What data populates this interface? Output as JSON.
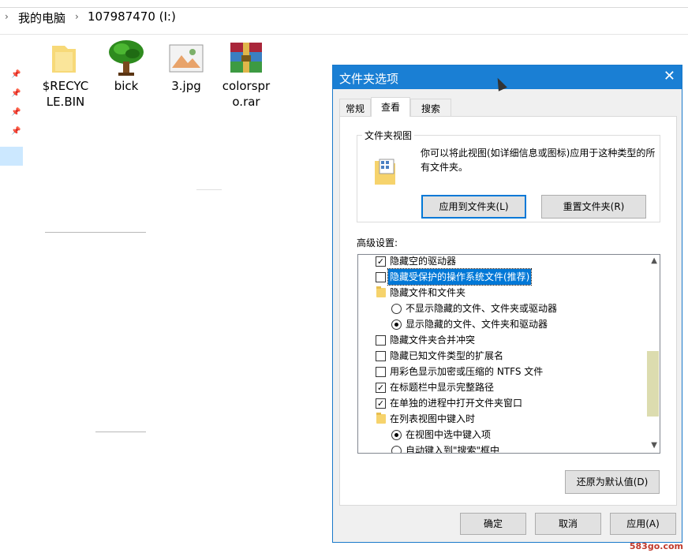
{
  "explorer": {
    "breadcrumb": [
      "我的电脑",
      "107987470 (I:)"
    ],
    "files": [
      {
        "name": "$RECYC\nLE.BIN",
        "icon": "folder-icon"
      },
      {
        "name": "bick",
        "icon": "tree-image-icon"
      },
      {
        "name": "3.jpg",
        "icon": "image-file-icon"
      },
      {
        "name": "colorspr\no.rar",
        "icon": "rar-archive-icon"
      }
    ]
  },
  "dialog": {
    "title": "文件夹选项",
    "close_label": "✕",
    "tabs": [
      "常规",
      "查看",
      "搜索"
    ],
    "active_tab": "查看",
    "folder_views": {
      "legend": "文件夹视图",
      "description": "你可以将此视图(如详细信息或图标)应用于这种类型的所有文件夹。",
      "apply_button": "应用到文件夹(L)",
      "reset_button": "重置文件夹(R)"
    },
    "advanced_label": "高级设置:",
    "advanced_items": [
      {
        "type": "checkbox",
        "checked": true,
        "label": "隐藏空的驱动器"
      },
      {
        "type": "checkbox",
        "checked": false,
        "label": "隐藏受保护的操作系统文件(推荐)",
        "selected": true
      },
      {
        "type": "folder",
        "label": "隐藏文件和文件夹"
      },
      {
        "type": "radio",
        "checked": false,
        "label": "不显示隐藏的文件、文件夹或驱动器"
      },
      {
        "type": "radio",
        "checked": true,
        "label": "显示隐藏的文件、文件夹和驱动器"
      },
      {
        "type": "checkbox",
        "checked": false,
        "label": "隐藏文件夹合并冲突"
      },
      {
        "type": "checkbox",
        "checked": false,
        "label": "隐藏已知文件类型的扩展名"
      },
      {
        "type": "checkbox",
        "checked": false,
        "label": "用彩色显示加密或压缩的 NTFS 文件"
      },
      {
        "type": "checkbox",
        "checked": true,
        "label": "在标题栏中显示完整路径"
      },
      {
        "type": "checkbox",
        "checked": true,
        "label": "在单独的进程中打开文件夹窗口"
      },
      {
        "type": "folder",
        "label": "在列表视图中键入时"
      },
      {
        "type": "radio",
        "checked": true,
        "label": "在视图中选中键入项"
      },
      {
        "type": "radio",
        "checked": false,
        "label": "自动键入到\"搜索\"框中"
      }
    ],
    "restore_defaults": "还原为默认值(D)",
    "ok": "确定",
    "cancel": "取消",
    "apply": "应用(A)"
  },
  "watermark": "583go.com"
}
